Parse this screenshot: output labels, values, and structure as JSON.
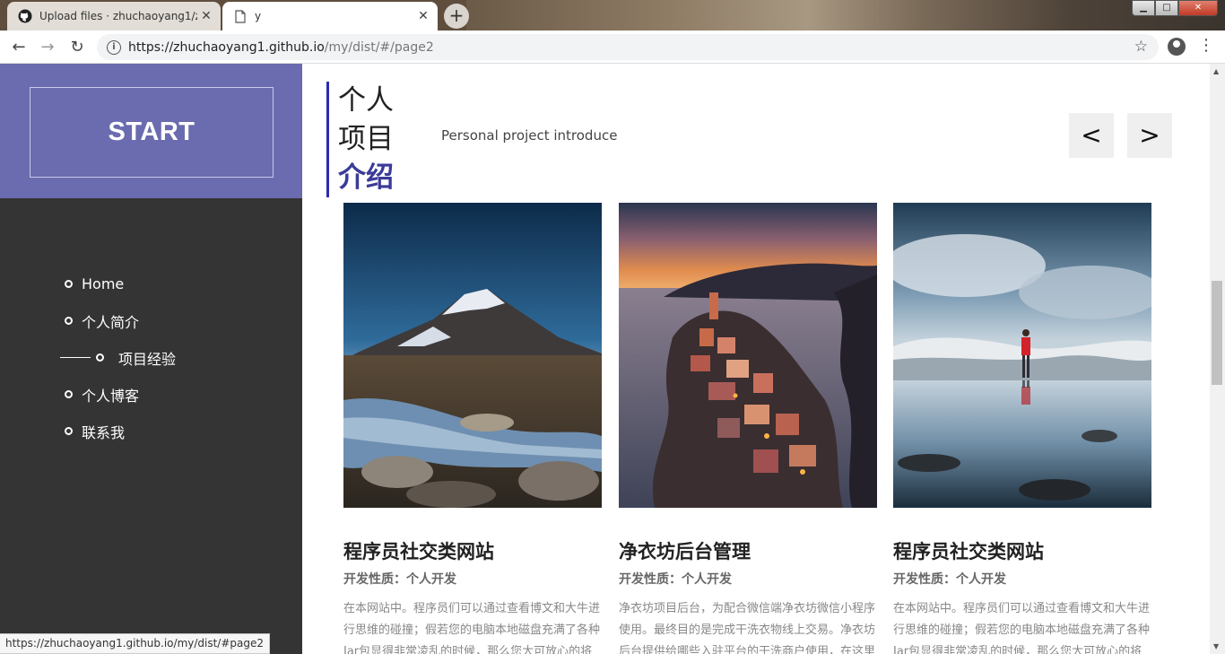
{
  "browser": {
    "tabs": [
      {
        "title": "Upload files · zhuchaoyang1/z",
        "icon": "github-icon",
        "active": false
      },
      {
        "title": "y",
        "icon": "page-icon",
        "active": true
      }
    ],
    "url_host": "https://zhuchaoyang1.github.io",
    "url_path": "/my/dist/#/page2",
    "status_url": "https://zhuchaoyang1.github.io/my/dist/#page2"
  },
  "sidebar": {
    "start_label": "START",
    "menu": [
      {
        "label": "Home",
        "active": false
      },
      {
        "label": "个人简介",
        "active": false
      },
      {
        "label": "项目经验",
        "active": true
      },
      {
        "label": "个人博客",
        "active": false
      },
      {
        "label": "联系我",
        "active": false
      }
    ]
  },
  "main": {
    "heading_line1": "个人",
    "heading_line2": "项目",
    "heading_line3": "介绍",
    "subtitle": "Personal project introduce",
    "prev_label": "<",
    "next_label": ">",
    "cards": [
      {
        "title": "程序员社交类网站",
        "meta": "开发性质：个人开发",
        "desc": "在本网站中。程序员们可以通过查看博文和大牛进行思维的碰撞；假若您的电脑本地磁盘充满了各种Jar包显得非常凌乱的时候，那么您大可放心的将",
        "image": "mountain-river-photo"
      },
      {
        "title": "净衣坊后台管理",
        "meta": "开发性质：个人开发",
        "desc": "净衣坊项目后台，为配合微信端净衣坊微信小程序使用。最终目的是完成干洗衣物线上交易。净衣坊后台提供给哪些入驻平台的干洗商户使用，在这里",
        "image": "coastal-village-photo"
      },
      {
        "title": "程序员社交类网站",
        "meta": "开发性质：个人开发",
        "desc": "在本网站中。程序员们可以通过查看博文和大牛进行思维的碰撞；假若您的电脑本地磁盘充满了各种Jar包显得非常凌乱的时候，那么您大可放心的将",
        "image": "glacier-reflection-photo"
      }
    ]
  },
  "colors": {
    "start_panel": "#6b6bb0",
    "sidebar": "#343434",
    "accent": "#3b3b98",
    "heading_bar": "#2b2bb2"
  }
}
